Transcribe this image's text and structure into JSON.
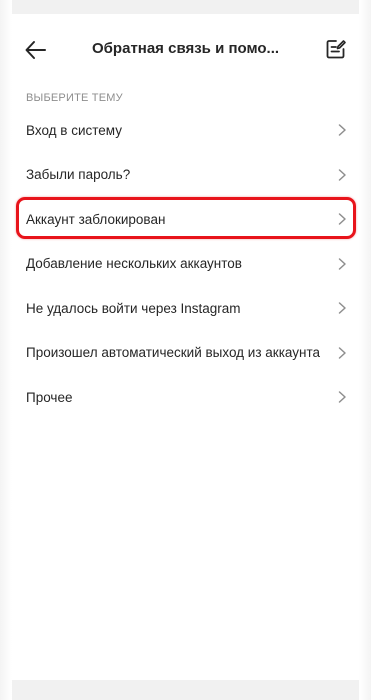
{
  "header": {
    "title": "Обратная связь и помо...",
    "back_icon": "arrow-left-icon",
    "edit_icon": "compose-icon"
  },
  "section": {
    "label": "ВЫБЕРИТЕ ТЕМУ"
  },
  "menu": {
    "items": [
      {
        "label": "Вход в систему"
      },
      {
        "label": "Забыли пароль?"
      },
      {
        "label": "Аккаунт заблокирован",
        "highlighted": true
      },
      {
        "label": "Добавление нескольких аккаунтов"
      },
      {
        "label": "Не удалось войти через Instagram"
      },
      {
        "label": "Произошел автоматический выход из аккаунта"
      },
      {
        "label": "Прочее"
      }
    ]
  },
  "colors": {
    "highlight": "#e8141b",
    "text": "#262626",
    "muted": "#8e8e8e",
    "chevron": "#8e8e8e"
  }
}
